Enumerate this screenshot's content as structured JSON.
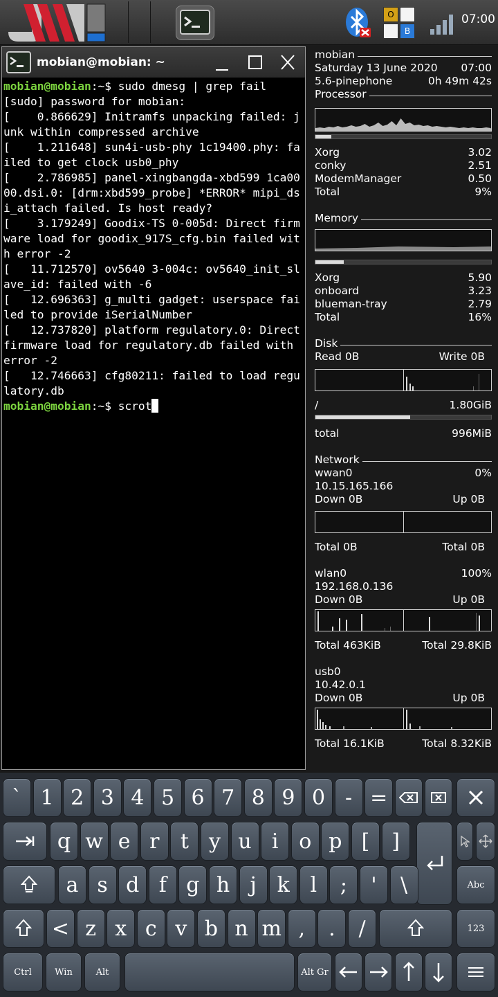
{
  "panel": {
    "clock": "07:00",
    "kbd_layout_letters": [
      "O",
      "",
      "",
      "B"
    ]
  },
  "terminal": {
    "title": "mobian@mobian: ~",
    "prompt_user": "mobian@mobian",
    "prompt_path": ":~$ ",
    "command1": "sudo dmesg | grep fail",
    "output": "[sudo] password for mobian:\n[    0.866629] Initramfs unpacking failed: junk within compressed archive\n[    1.211648] sun4i-usb-phy 1c19400.phy: failed to get clock usb0_phy\n[    2.786985] panel-xingbangda-xbd599 1ca0000.dsi.0: [drm:xbd599_probe] *ERROR* mipi_dsi_attach failed. Is host ready?\n[    3.179249] Goodix-TS 0-005d: Direct firmware load for goodix_917S_cfg.bin failed with error -2\n[   11.712570] ov5640 3-004c: ov5640_init_slave_id: failed with -6\n[   12.696363] g_multi gadget: userspace failed to provide iSerialNumber\n[   12.737820] platform regulatory.0: Direct firmware load for regulatory.db failed with error -2\n[   12.746663] cfg80211: failed to load regulatory.db",
    "command2": "scrot"
  },
  "conky": {
    "hostname": "mobian",
    "date": "Saturday 13 June 2020",
    "time": "07:00",
    "kernel": "5.6-pinephone",
    "uptime": "0h 49m 42s",
    "processor": {
      "label": "Processor",
      "usage_fraction": 0.09,
      "top": [
        {
          "name": "Xorg",
          "value": "3.02"
        },
        {
          "name": "conky",
          "value": "2.51"
        },
        {
          "name": "ModemManager",
          "value": "0.50"
        },
        {
          "name": "Total",
          "value": "9%"
        }
      ]
    },
    "memory": {
      "label": "Memory",
      "usage_fraction": 0.16,
      "top": [
        {
          "name": "Xorg",
          "value": "5.90"
        },
        {
          "name": "onboard",
          "value": "3.23"
        },
        {
          "name": "blueman-tray",
          "value": "2.79"
        },
        {
          "name": "Total",
          "value": "16%"
        }
      ]
    },
    "disk": {
      "label": "Disk",
      "read": "Read 0B",
      "write": "Write 0B",
      "root_label": "/",
      "root_value": "1.80GiB",
      "root_fraction": 0.54,
      "total_label": "total",
      "total_value": "996MiB"
    },
    "network": {
      "label": "Network",
      "interfaces": [
        {
          "name": "wwan0",
          "percent": "0%",
          "ip": "10.15.165.166",
          "down": "Down 0B",
          "up": "Up 0B",
          "total_down": "Total 0B",
          "total_up": "Total 0B"
        },
        {
          "name": "wlan0",
          "percent": "100%",
          "ip": "192.168.0.136",
          "down": "Down 0B",
          "up": "Up 0B",
          "total_down": "Total 463KiB",
          "total_up": "Total 29.8KiB"
        },
        {
          "name": "usb0",
          "percent": "",
          "ip": "10.42.0.1",
          "down": "Down 0B",
          "up": "Up 0B",
          "total_down": "Total 16.1KiB",
          "total_up": "Total 8.32KiB"
        }
      ]
    }
  },
  "keyboard": {
    "row1": [
      "`",
      "1",
      "2",
      "3",
      "4",
      "5",
      "6",
      "7",
      "8",
      "9",
      "0",
      "-",
      "="
    ],
    "row2": [
      "q",
      "w",
      "e",
      "r",
      "t",
      "y",
      "u",
      "i",
      "o",
      "p",
      "[",
      "]"
    ],
    "row3": [
      "a",
      "s",
      "d",
      "f",
      "g",
      "h",
      "j",
      "k",
      "l",
      ";",
      "'",
      "\\"
    ],
    "row4": [
      "<",
      "z",
      "x",
      "c",
      "v",
      "b",
      "n",
      "m",
      ",",
      ".",
      "/"
    ],
    "abc_label": "Abc",
    "num_label": "123",
    "ctrl": "Ctrl",
    "win": "Win",
    "alt": "Alt",
    "altgr": "Alt Gr"
  }
}
